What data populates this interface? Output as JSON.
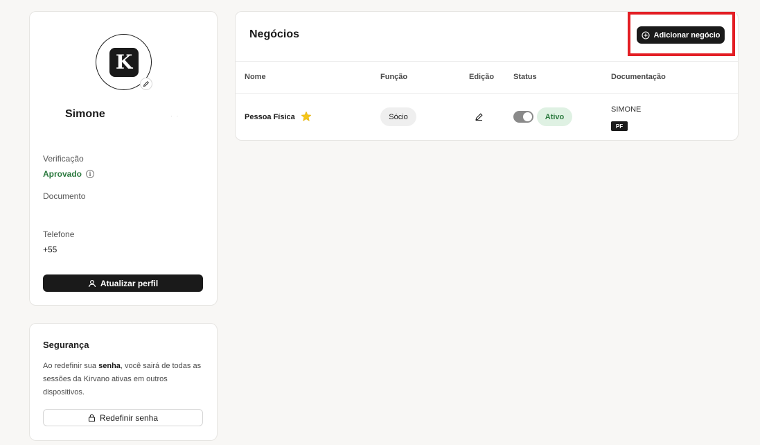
{
  "profile": {
    "avatar_letter": "K",
    "name": "Simone",
    "verification_label": "Verificação",
    "verification_value": "Aprovado",
    "document_label": "Documento",
    "document_value": "",
    "phone_label": "Telefone",
    "phone_value": "+55",
    "update_button": "Atualizar perfil"
  },
  "security": {
    "title": "Segurança",
    "text_before": "Ao redefinir sua ",
    "text_bold": "senha",
    "text_after": ", você sairá de todas as sessões da Kirvano ativas em outros dispositivos.",
    "reset_button": "Redefinir senha"
  },
  "business": {
    "title": "Negócios",
    "add_button": "Adicionar negócio",
    "columns": [
      "Nome",
      "Função",
      "Edição",
      "Status",
      "Documentação"
    ],
    "rows": [
      {
        "name": "Pessoa Física",
        "role": "Sócio",
        "status": "Ativo",
        "doc_name": "SIMONE",
        "doc_type": "PF"
      }
    ]
  },
  "colors": {
    "accent_dark": "#1a1a1a",
    "success": "#2c7a3f",
    "highlight": "#e31e24",
    "star": "#f5c518"
  }
}
